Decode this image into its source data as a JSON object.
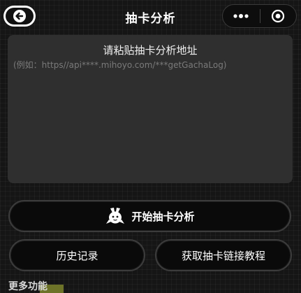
{
  "header": {
    "title": "抽卡分析"
  },
  "paste": {
    "title": "请粘贴抽卡分析地址",
    "placeholder": "(例如：https//api****.mihoyo.com/***getGachaLog)"
  },
  "buttons": {
    "start": "开始抽卡分析",
    "history": "历史记录",
    "tutorial": "获取抽卡链接教程"
  },
  "section": {
    "more": "更多功能"
  },
  "icons": {
    "back": "back-arrow-icon",
    "more": "more-dots-icon",
    "target": "target-icon",
    "mascot": "paimon-mascot-icon"
  },
  "colors": {
    "background": "#151515",
    "panel": "#2f2f2f",
    "button": "#0a0a0a",
    "accent_bar": "#6d7328"
  }
}
